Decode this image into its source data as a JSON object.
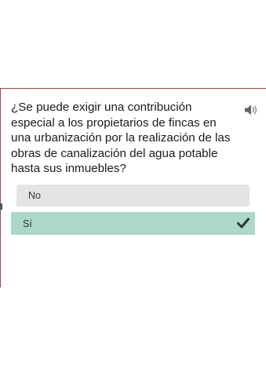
{
  "question": {
    "text": "¿Se puede exigir una contribución especial a los propietarios de fincas en una urbanización por la realización de las obras de canalización del agua potable hasta sus inmuebles?",
    "audio_icon": "speaker-icon"
  },
  "answers": [
    {
      "label": "No",
      "selected": false
    },
    {
      "label": "Sí",
      "selected": true,
      "icon": "checkmark-icon"
    }
  ],
  "colors": {
    "accent_line": "#a94442",
    "option_default": "#e4e4e4",
    "option_selected": "#abd8c8",
    "check": "#333333"
  }
}
